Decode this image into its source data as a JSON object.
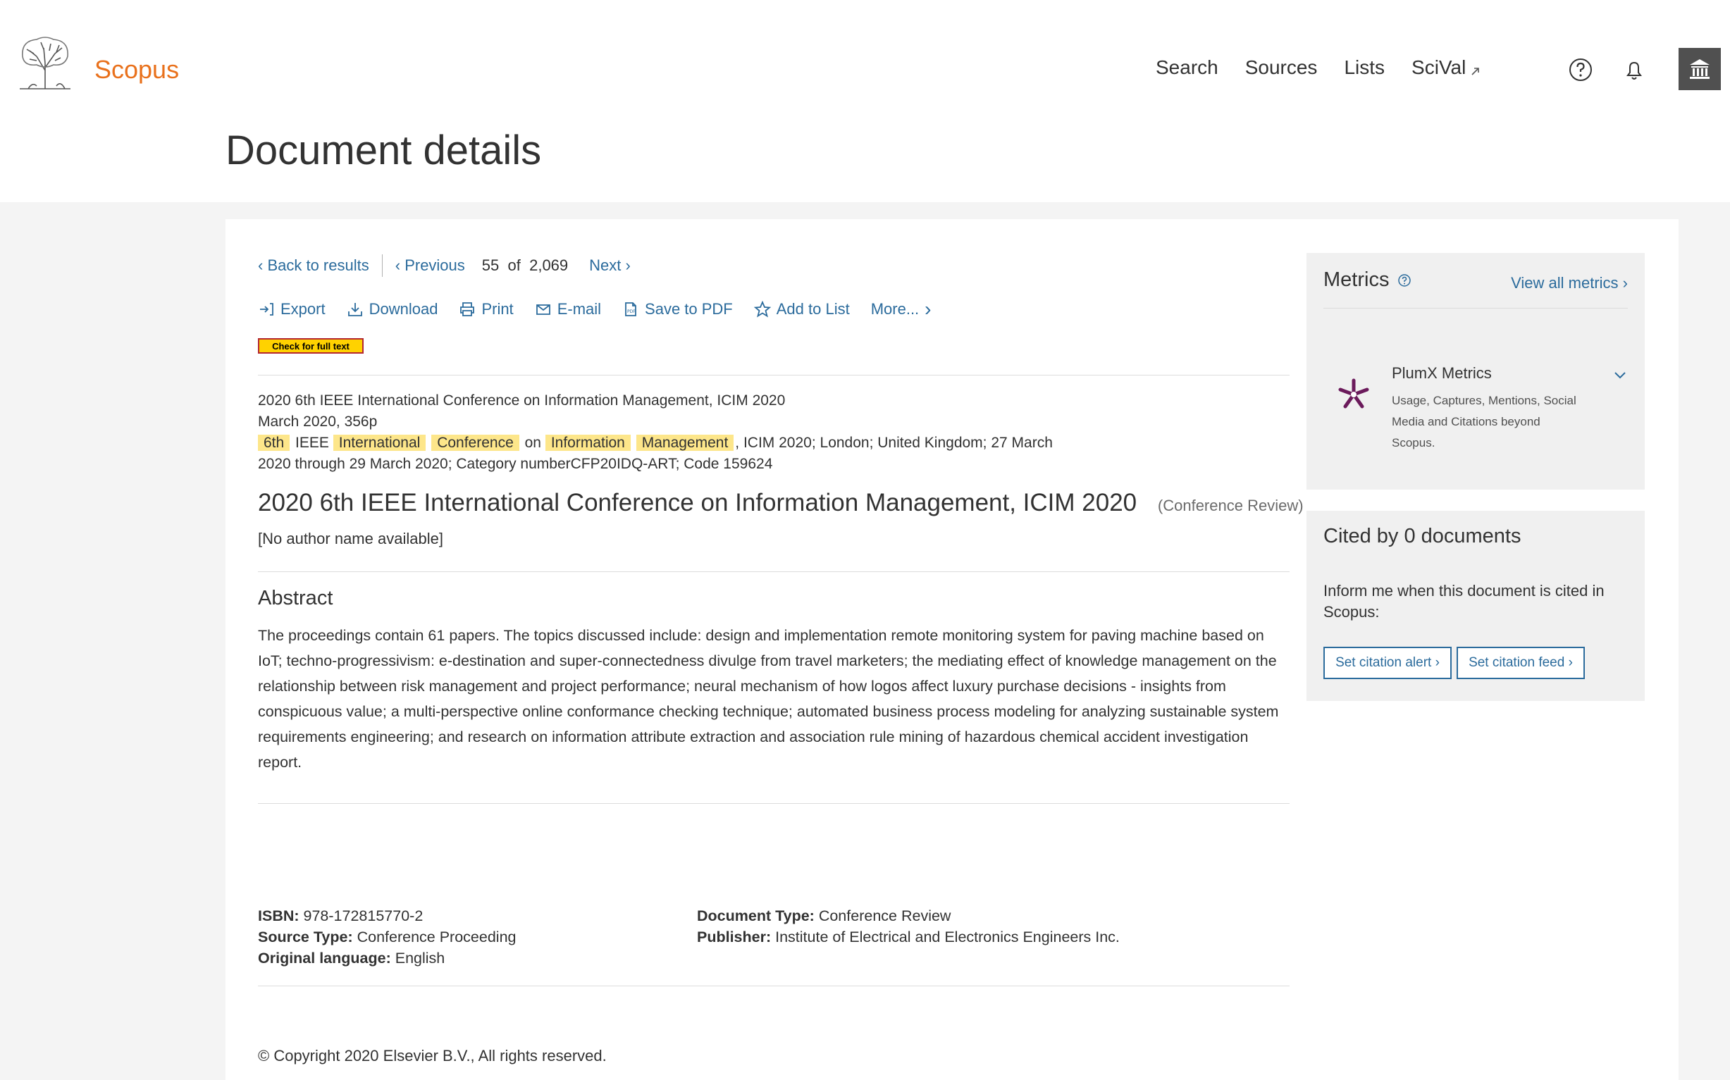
{
  "header": {
    "brand": "Scopus",
    "nav": [
      "Search",
      "Sources",
      "Lists",
      "SciVal"
    ],
    "page_title": "Document details"
  },
  "navigation": {
    "back": "Back to results",
    "previous": "Previous",
    "current": "55",
    "of": "of",
    "total": "2,069",
    "next": "Next"
  },
  "toolbar": {
    "export": "Export",
    "download": "Download",
    "print": "Print",
    "email": "E-mail",
    "save_pdf": "Save to PDF",
    "add_list": "Add to List",
    "more": "More..."
  },
  "full_text_button": "Check for full text",
  "source": {
    "line1": "2020 6th IEEE International Conference on Information Management, ICIM 2020",
    "line2": "March 2020, 356p",
    "hl_6th": "6th",
    "ieee": "IEEE",
    "hl_international": "International",
    "hl_conference": "Conference",
    "on": "on",
    "hl_information": "Information",
    "hl_management": "Management",
    "rest": ", ICIM 2020; London; United Kingdom; 27 March",
    "line4": "2020 through 29 March 2020; Category numberCFP20IDQ-ART; Code 159624"
  },
  "document": {
    "title": "2020 6th IEEE International Conference on Information Management, ICIM 2020",
    "type": "(Conference Review)",
    "author": "[No author name available]"
  },
  "abstract": {
    "heading": "Abstract",
    "text": "The proceedings contain 61 papers. The topics discussed include: design and implementation remote monitoring system for paving machine based on IoT; techno-progressivism: e-destination and super-connectedness divulge from travel marketers; the mediating effect of knowledge management on the relationship between risk management and project performance; neural mechanism of how logos affect luxury purchase decisions - insights from conspicuous value; a multi-perspective online conformance checking technique; automated business process modeling for analyzing sustainable system requirements engineering; and research on information attribute extraction and association rule mining of hazardous chemical accident investigation report."
  },
  "meta": {
    "isbn_label": "ISBN:",
    "isbn": "978-172815770-2",
    "source_type_label": "Source Type:",
    "source_type": "Conference Proceeding",
    "language_label": "Original language:",
    "language": "English",
    "doctype_label": "Document Type:",
    "doctype": "Conference Review",
    "publisher_label": "Publisher:",
    "publisher": "Institute of Electrical and Electronics Engineers Inc."
  },
  "copyright": "© Copyright 2020 Elsevier B.V., All rights reserved.",
  "metrics": {
    "heading": "Metrics",
    "view_all": "View all metrics",
    "plumx_title": "PlumX Metrics",
    "plumx_desc": "Usage, Captures, Mentions, Social Media and Citations beyond Scopus."
  },
  "cited": {
    "heading": "Cited by 0 documents",
    "text": "Inform me when this document is cited in Scopus:",
    "alert_btn": "Set citation alert",
    "feed_btn": "Set citation feed"
  },
  "colors": {
    "brand": "#e9711c",
    "link": "#2b6b9c",
    "highlight": "#fde68a",
    "plumx": "#6b1a5b"
  }
}
